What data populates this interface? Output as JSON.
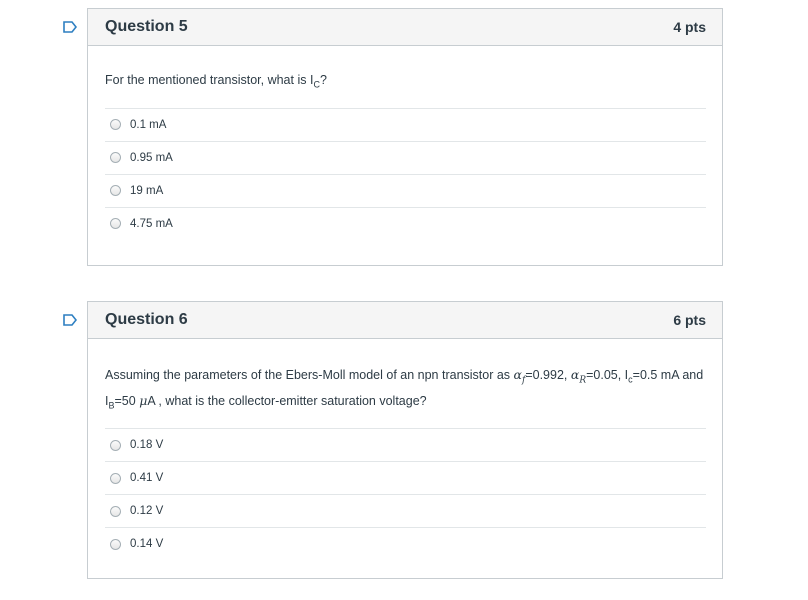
{
  "questions": [
    {
      "title": "Question 5",
      "points": "4 pts",
      "text_before": "For the mentioned transistor, what is I",
      "text_sub": "C",
      "text_after": "?",
      "answers": [
        "0.1 mA",
        "0.95 mA",
        "19 mA",
        "4.75 mA"
      ]
    },
    {
      "title": "Question 6",
      "points": "6 pts",
      "text_parts": {
        "p1": "Assuming the parameters of the Ebers-Moll model of an npn transistor as ",
        "alpha_f": "α",
        "sub_f": "f",
        "p2": "=0.992, ",
        "alpha_r": "α",
        "sub_r": "R",
        "p3": "=0.05, I",
        "sub_c": "c",
        "p4": "=0.5 mA and I",
        "sub_b": "B",
        "p5": "=50 ",
        "mu": "μ",
        "p6": "A , what is the collector-emitter saturation voltage?"
      },
      "answers": [
        "0.18 V",
        "0.41 V",
        "0.12 V",
        "0.14 V"
      ]
    }
  ],
  "colors": {
    "flag": "#2d7fc1",
    "border": "#c7cdd1",
    "header_bg": "#f5f5f5"
  }
}
